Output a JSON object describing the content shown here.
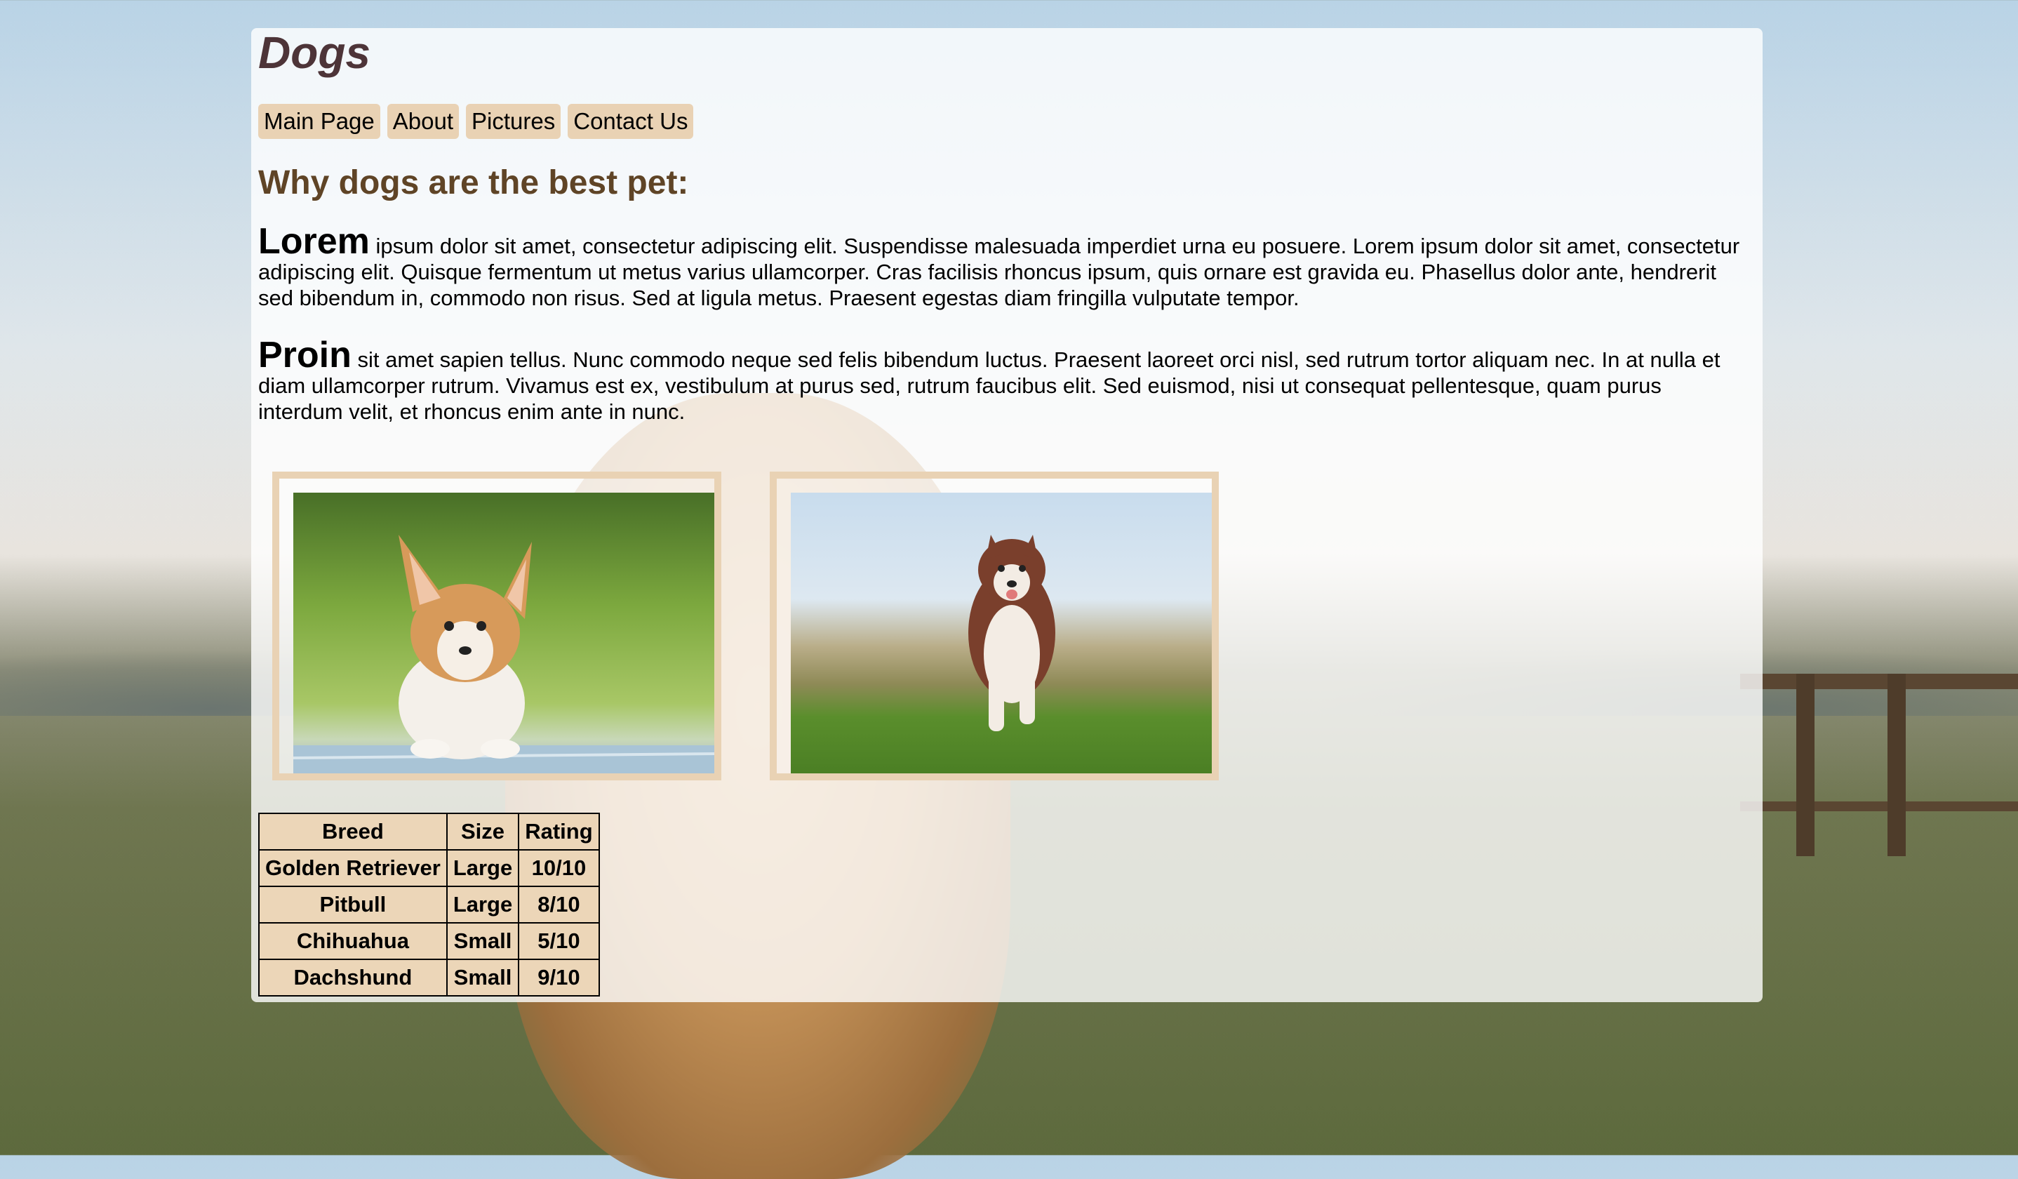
{
  "site": {
    "title": "Dogs"
  },
  "nav": [
    {
      "label": "Main Page"
    },
    {
      "label": "About"
    },
    {
      "label": "Pictures"
    },
    {
      "label": "Contact Us"
    }
  ],
  "main": {
    "heading": "Why dogs are the best pet:",
    "paragraphs": [
      {
        "lead": "Lorem",
        "text": " ipsum dolor sit amet, consectetur adipiscing elit. Suspendisse malesuada imperdiet urna eu posuere. Lorem ipsum dolor sit amet, consectetur adipiscing elit. Quisque fermentum ut metus varius ullamcorper. Cras facilisis rhoncus ipsum, quis ornare est gravida eu. Phasellus dolor ante, hendrerit sed bibendum in, commodo non risus. Sed at ligula metus. Praesent egestas diam fringilla vulputate tempor."
      },
      {
        "lead": "Proin",
        "text": " sit amet sapien tellus. Nunc commodo neque sed felis bibendum luctus. Praesent laoreet orci nisl, sed rutrum tortor aliquam nec. In at nulla et diam ullamcorper rutrum. Vivamus est ex, vestibulum at purus sed, rutrum faucibus elit. Sed euismod, nisi ut consequat pellentesque, quam purus interdum velit, et rhoncus enim ante in nunc."
      }
    ]
  },
  "table": {
    "headers": [
      "Breed",
      "Size",
      "Rating"
    ],
    "rows": [
      [
        "Golden Retriever",
        "Large",
        "10/10"
      ],
      [
        "Pitbull",
        "Large",
        "8/10"
      ],
      [
        "Chihuahua",
        "Small",
        "5/10"
      ],
      [
        "Dachshund",
        "Small",
        "9/10"
      ]
    ]
  },
  "colors": {
    "accent": "#e9d2b4",
    "title": "#4d3438",
    "heading": "#5f4426"
  }
}
